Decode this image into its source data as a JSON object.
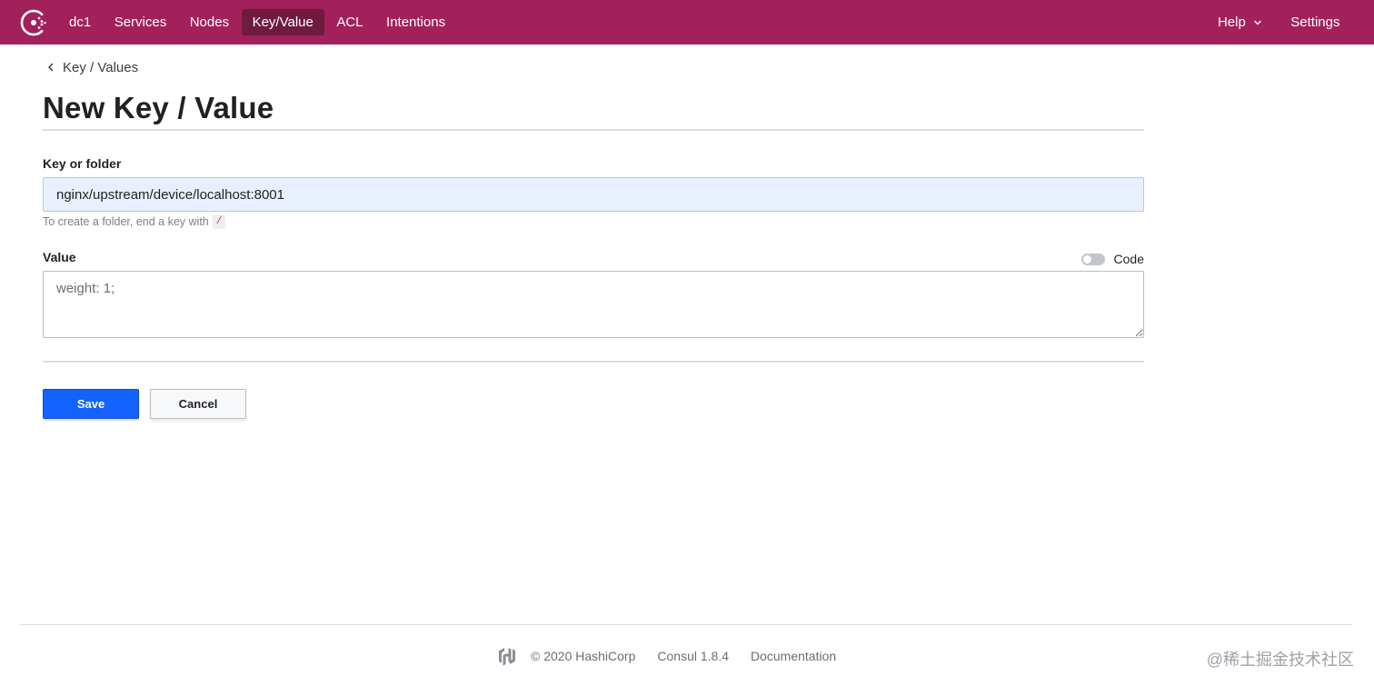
{
  "nav": {
    "datacenter": "dc1",
    "items": [
      {
        "label": "Services",
        "active": false
      },
      {
        "label": "Nodes",
        "active": false
      },
      {
        "label": "Key/Value",
        "active": true
      },
      {
        "label": "ACL",
        "active": false
      },
      {
        "label": "Intentions",
        "active": false
      }
    ],
    "help_label": "Help",
    "settings_label": "Settings",
    "color": "#a2215a",
    "active_color": "#6e1b3f"
  },
  "breadcrumb": {
    "label": "Key / Values"
  },
  "page": {
    "title": "New Key / Value"
  },
  "form": {
    "key_label": "Key or folder",
    "key_value": "nginx/upstream/device/localhost:8001",
    "hint_text": "To create a folder, end a key with",
    "hint_code": "/",
    "value_label": "Value",
    "code_toggle_label": "Code",
    "code_toggle_on": false,
    "value_text": "weight: 1;"
  },
  "actions": {
    "save_label": "Save",
    "cancel_label": "Cancel",
    "save_color": "#1563ff"
  },
  "footer": {
    "copyright": "© 2020 HashiCorp",
    "version": "Consul 1.8.4",
    "docs_label": "Documentation"
  },
  "watermark": "@稀土掘金技术社区"
}
